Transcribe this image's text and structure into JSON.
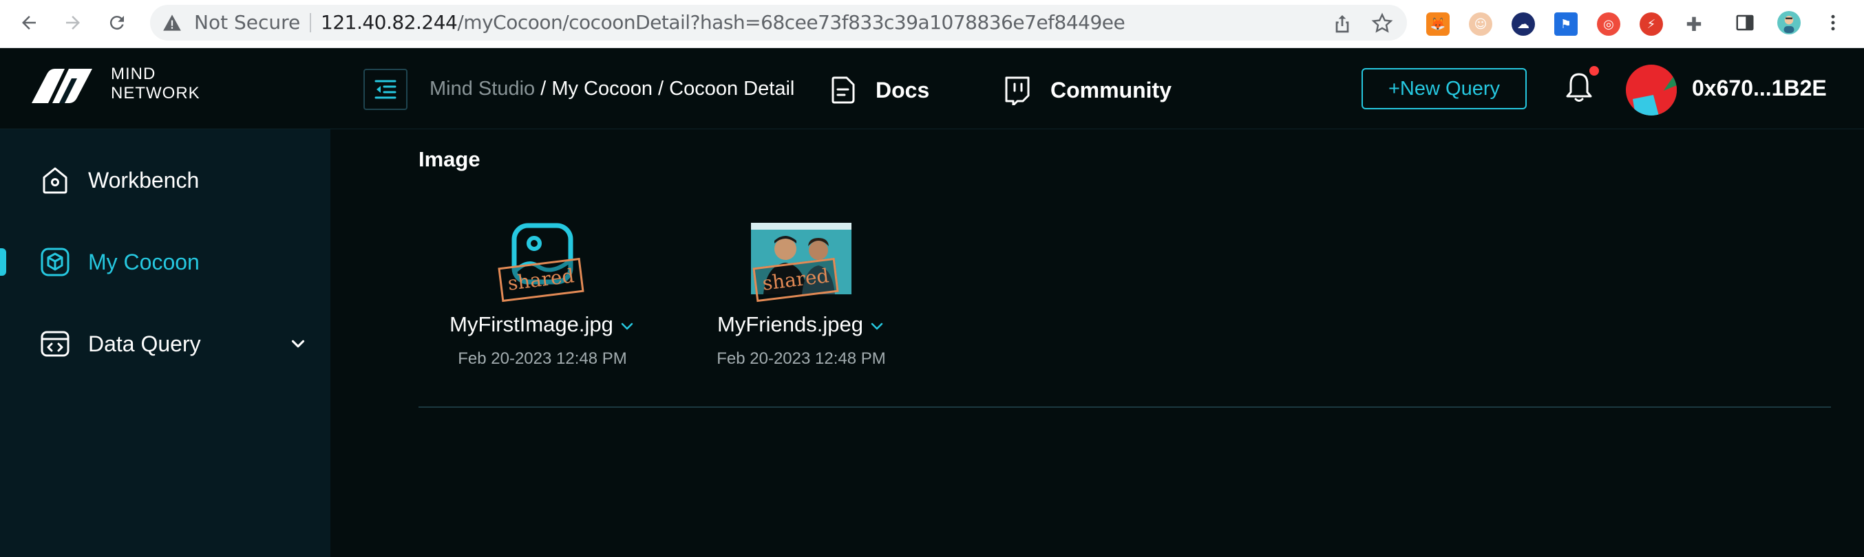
{
  "browser": {
    "security_label": "Not Secure",
    "url_host": "121.40.82.244",
    "url_path": "/myCocoon/cocoonDetail?hash=68cee73f833c39a1078836e7ef8449ee"
  },
  "brand": {
    "line1": "MIND",
    "line2": "NETWORK",
    "accent_color": "#26c8e0"
  },
  "sidebar": {
    "items": [
      {
        "label": "Workbench",
        "icon": "home-icon",
        "active": false
      },
      {
        "label": "My Cocoon",
        "icon": "cube-icon",
        "active": true
      },
      {
        "label": "Data Query",
        "icon": "code-window-icon",
        "active": false,
        "expandable": true
      }
    ]
  },
  "header": {
    "breadcrumb": {
      "root": "Mind Studio",
      "sep1": " / ",
      "mid": "My Cocoon",
      "sep2": " / ",
      "current": "Cocoon Detail"
    },
    "docs_label": "Docs",
    "community_label": "Community",
    "new_query_label": "+New Query",
    "wallet_address": "0x670...1B2E"
  },
  "main": {
    "section_title": "Image",
    "files": [
      {
        "name": "MyFirstImage.jpg",
        "date": "Feb 20-2023 12:48 PM",
        "stamp": "shared",
        "thumb": "image-placeholder-icon"
      },
      {
        "name": "MyFriends.jpeg",
        "date": "Feb 20-2023 12:48 PM",
        "stamp": "shared",
        "thumb": "photo-thumbnail"
      }
    ]
  }
}
